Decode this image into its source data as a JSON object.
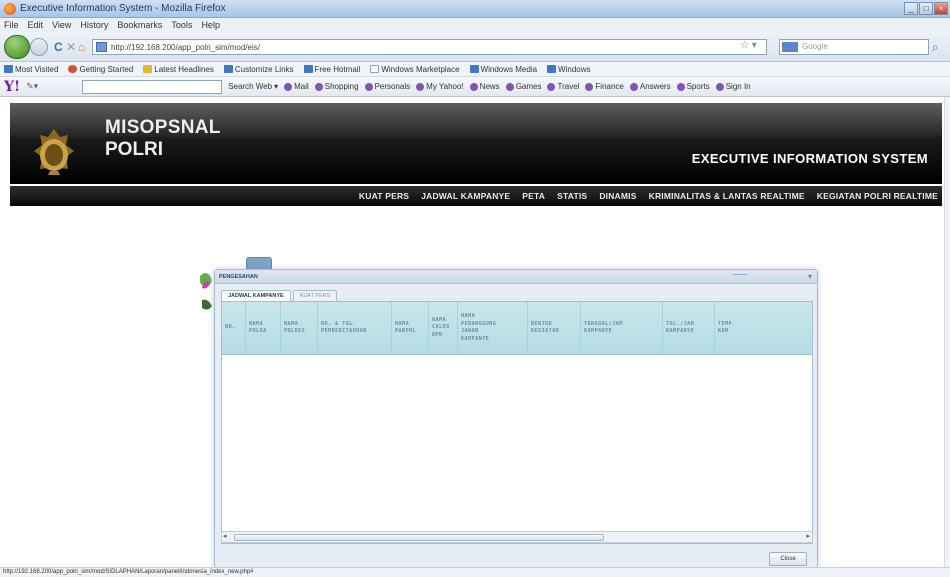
{
  "window": {
    "title": "Executive Information System - Mozilla Firefox"
  },
  "menu": [
    "File",
    "Edit",
    "View",
    "History",
    "Bookmarks",
    "Tools",
    "Help"
  ],
  "nav": {
    "url": "http://192.168.200/app_polri_sim/mod/eis/",
    "search_placeholder": "Google"
  },
  "bookmarks": [
    "Most Visited",
    "Getting Started",
    "Latest Headlines",
    "Customize Links",
    "Free Hotmail",
    "Windows Marketplace",
    "Windows Media",
    "Windows"
  ],
  "yahoo_toolbar": {
    "search_label": "Search Web",
    "links": [
      "Mail",
      "Shopping",
      "Personals",
      "My Yahoo!",
      "News",
      "Games",
      "Travel",
      "Finance",
      "Answers",
      "Sports",
      "Sign In"
    ]
  },
  "app": {
    "name_line1": "MISOPSNAL",
    "name_line2": "POLRI",
    "subtitle": "EXECUTIVE INFORMATION SYSTEM",
    "nav": [
      "KUAT PERS",
      "JADWAL KAMPANYE",
      "PETA",
      "STATIS",
      "DINAMIS",
      "KRIMINALITAS & LANTAS REALTIME",
      "KEGIATAN POLRI REALTIME"
    ]
  },
  "dialog": {
    "title": "PENGESAHAN",
    "tabs": [
      "JADWAL KAMPANYE",
      "KUAT PERS"
    ],
    "columns": [
      "NO.",
      "NAMA\nPOLDA",
      "NAMA\nPOLRES",
      "NO. & TGL.\nPEMBERITAHUAN",
      "NAMA\nPARPOL",
      "NAMA\nCALEG\nDPD",
      "NAMA\nPENANGGUNG\nJAWAB\nKAMPANYE",
      "BENTUK\nKEGIATAN",
      "TANGGAL/JAM\nKAMPANYE",
      "TGL./JAM\nKAMPANYE",
      "TEMP\nKAM"
    ],
    "close_label": "Close"
  },
  "status": {
    "text": "http://192.168.200/app_polri_sim/mod/SIDLAPHAN/Laporan/panel/indonesia_index_new.php#"
  }
}
